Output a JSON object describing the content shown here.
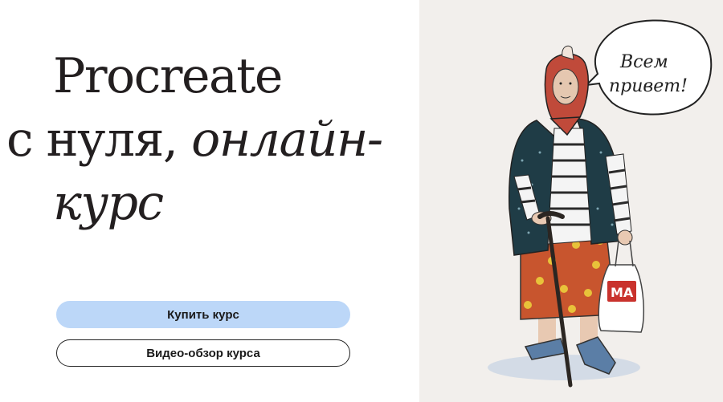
{
  "hero": {
    "title_line1": "Procreate",
    "title_line2_plain": "с нуля, ",
    "title_line2_italic": "онлайн-",
    "title_line3_italic": "курс"
  },
  "buttons": {
    "buy_label": "Купить курс",
    "video_label": "Видео-обзор курса"
  },
  "illustration": {
    "speech_line1": "Всем",
    "speech_line2": "привет!",
    "bag_logo": "МА"
  },
  "colors": {
    "buy_button": "#bcd7f8",
    "illustration_bg": "#f2efec",
    "text": "#231f20"
  }
}
